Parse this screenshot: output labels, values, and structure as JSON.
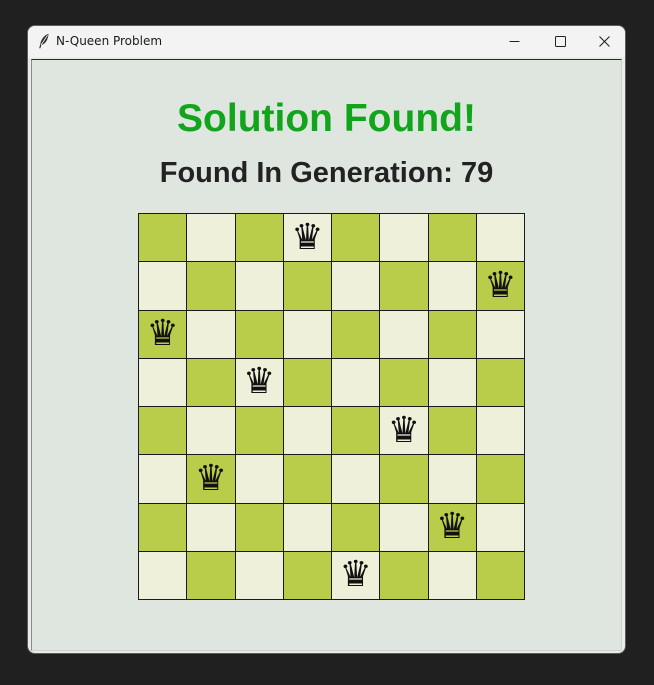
{
  "window": {
    "title": "N-Queen Problem",
    "icon": "feather-icon",
    "controls": [
      "minimize-icon",
      "maximize-icon",
      "close-icon"
    ]
  },
  "status": {
    "headline": "Solution Found!",
    "generation_text": "Found In Generation: 79",
    "generation": 79
  },
  "board": {
    "size": 8,
    "queen_columns_by_row": [
      3,
      7,
      0,
      2,
      5,
      1,
      6,
      4
    ],
    "queen_glyph": "♛",
    "colors": {
      "dark_square": "#bacd4a",
      "light_square": "#eff0d9",
      "headline": "#12a51c"
    }
  }
}
